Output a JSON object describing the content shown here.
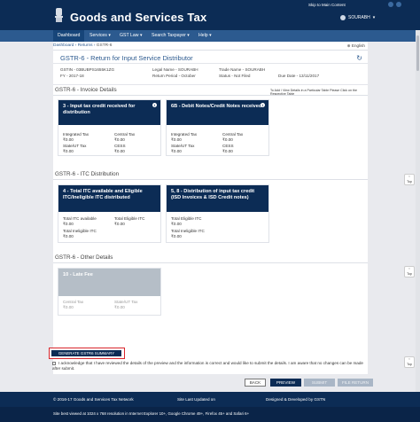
{
  "header": {
    "brand": "Goods and Services Tax",
    "skip_link": "Skip to Main Content",
    "user_name": "SOURABH"
  },
  "nav": {
    "items": [
      "Dashboard",
      "Services ▾",
      "GST Law ▾",
      "Search Taxpayer ▾",
      "Help ▾"
    ]
  },
  "breadcrumb": {
    "dashboard": "Dashboard",
    "sep1": " › ",
    "returns": "Returns",
    "sep2": " › ",
    "current": "GSTR-6",
    "language": "English"
  },
  "page": {
    "title": "GSTR-6 - Return for Input Service Distributor",
    "gstin": "GSTIN - 03BUBPS1655K1ZG",
    "fy": "FY - 2017-18",
    "legal_name": "Legal Name - SOURABH",
    "return_period": "Return Period - October",
    "trade_name": "Trade Name - SOURABH",
    "status": "Status - Not Filed",
    "due_date": "Due Date - 13/11/2017"
  },
  "sections": {
    "invoice": "GSTR-6 - Invoice Details",
    "invoice_note": "To Add / View Details in a Particular Table Please Click on the Respective Table",
    "itc": "GSTR-6 - ITC Distribution",
    "other": "GSTR-6 - Other Details"
  },
  "cards": {
    "c3": {
      "title": "3 - Input tax credit received for distribution",
      "l1": "Integrated Tax",
      "v1": "₹0.00",
      "l2": "Central Tax",
      "v2": "₹0.00",
      "l3": "State/UT Tax",
      "v3": "₹0.00",
      "l4": "CESS",
      "v4": "₹0.00"
    },
    "c6b": {
      "title": "6B - Debit Notes/Credit Notes received",
      "l1": "Integrated Tax",
      "v1": "₹0.00",
      "l2": "Central Tax",
      "v2": "₹0.00",
      "l3": "State/UT Tax",
      "v3": "₹0.00",
      "l4": "CESS",
      "v4": "₹0.00"
    },
    "c4": {
      "title": "4 - Total ITC available and Eligible ITC/Ineligible ITC distributed",
      "l1": "Total ITC available",
      "v1": "₹0.00",
      "l2": "Total Eligible ITC",
      "v2": "₹0.00",
      "l3": "Total Ineligible ITC",
      "v3": "₹0.00"
    },
    "c58": {
      "title": "5, 8 - Distribution of input tax credit (ISD Invoices & ISD Credit notes)",
      "l1": "Total Eligible ITC",
      "v1": "₹0.00",
      "l2": "Total Ineligible ITC",
      "v2": "₹0.00"
    },
    "c10": {
      "title": "10 - Late Fee",
      "l1": "Central Tax",
      "v1": "₹0.00",
      "l2": "State/UT Tax",
      "v2": "₹0.00"
    }
  },
  "actions": {
    "generate": "GENERATE GSTR6 SUMMARY",
    "ack": "I acknowledge that I have reviewed the details of the preview and the information is correct and would like to submit the details. I am aware that no changes can be made after submit.",
    "back": "BACK",
    "preview": "PREVIEW",
    "submit": "SUBMIT",
    "file_return": "FILE RETURN"
  },
  "footer": {
    "copyright": "© 2016-17 Goods and Services Tax Network",
    "updated": "Site Last Updated on",
    "designed": "Designed & Developed by GSTN",
    "browser_note": "Site best viewed at 1024 x 768 resolution in Internet Explorer 10+, Google Chrome 49+, Firefox 45+ and Safari 6+"
  },
  "top_button": "Top",
  "colors": {
    "header": "#0c2c55",
    "nav": "#2c5a8f",
    "highlight": "#d9262c"
  }
}
